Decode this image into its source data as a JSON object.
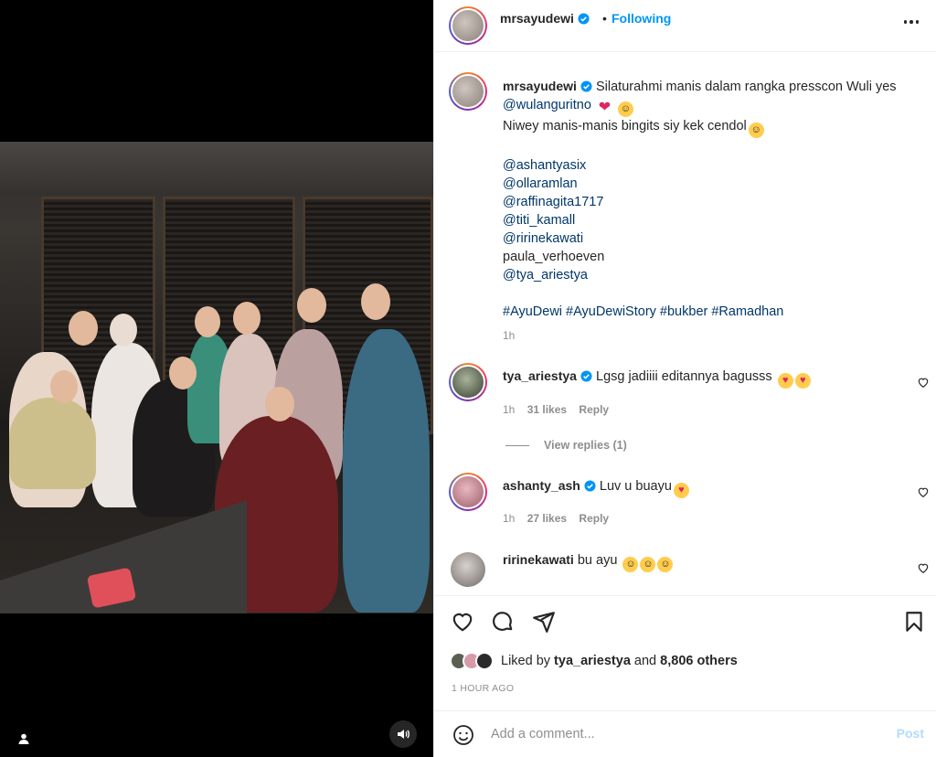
{
  "header": {
    "username": "mrsayudewi",
    "separator": "•",
    "follow_label": "Following"
  },
  "caption": {
    "username": "mrsayudewi",
    "line1": "Silaturahmi manis dalam rangka presscon Wuli yes",
    "mention_main": "@wulanguritno",
    "line2": "Niwey manis-manis bingits siy kek cendol",
    "tags": [
      "@ashantyasix",
      "@ollaramlan",
      "@raffinagita1717",
      "@titi_kamall",
      "@ririnekawati",
      "paula_verhoeven",
      "@tya_ariestya"
    ],
    "hashtags": "#AyuDewi #AyuDewiStory #bukber #Ramadhan",
    "time": "1h"
  },
  "comments": [
    {
      "username": "tya_ariestya",
      "verified": true,
      "text": "Lgsg jadiiii editannya bagusss",
      "time": "1h",
      "likes": "31 likes",
      "reply": "Reply",
      "view_replies": "View replies (1)"
    },
    {
      "username": "ashanty_ash",
      "verified": true,
      "text": "Luv u buayu",
      "time": "1h",
      "likes": "27 likes",
      "reply": "Reply"
    },
    {
      "username": "ririnekawati",
      "verified": false,
      "text": "bu ayu",
      "time": "",
      "likes": "",
      "reply": ""
    }
  ],
  "likes": {
    "prefix": "Liked by",
    "user": "tya_ariestya",
    "middle": "and",
    "others": "8,806 others"
  },
  "timestamp": "1 HOUR AGO",
  "comment_box": {
    "placeholder": "Add a comment...",
    "post_label": "Post"
  },
  "colors": {
    "link": "#00376b",
    "accent": "#0095f6",
    "post_disabled": "#b3dbff",
    "muted": "#8e8e8e"
  },
  "icons": [
    "user-tag-icon",
    "volume-icon",
    "verified-badge-icon",
    "more-icon",
    "heart-icon",
    "comment-icon",
    "share-icon",
    "bookmark-icon",
    "emoji-icon"
  ]
}
